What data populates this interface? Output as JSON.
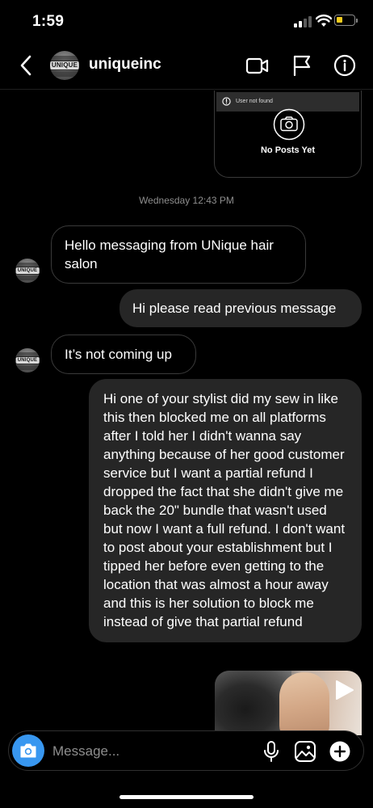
{
  "status_bar": {
    "time": "1:59",
    "battery_level": 0.25,
    "battery_color": "#f4cc1e"
  },
  "header": {
    "username": "uniqueinc",
    "avatar_text": "UNIQUE",
    "icons": [
      "back-chevron-icon",
      "video-call-icon",
      "flag-icon",
      "info-icon"
    ]
  },
  "shared_post": {
    "warning": "User not found",
    "empty_label": "No Posts Yet",
    "icons": [
      "alert-circle-icon",
      "camera-icon"
    ]
  },
  "timestamp": "Wednesday 12:43 PM",
  "messages": [
    {
      "direction": "received",
      "text": "Hello messaging from UNique hair salon"
    },
    {
      "direction": "sent",
      "text": "Hi please read previous message"
    },
    {
      "direction": "received",
      "text": "It’s not coming up"
    },
    {
      "direction": "sent",
      "text": "Hi one of your stylist did my sew in like this then blocked me on all platforms after I told her I didn't wanna say anything because of her good customer service but I want a partial refund I dropped the fact that she didn't give me back the 20\" bundle that wasn't used but now I want a full refund. I don't want to post about your establishment but I tipped her before even getting to the location that was almost a hour away and this is her solution to block me instead of give that partial refund"
    },
    {
      "direction": "sent",
      "type": "video",
      "icon": "play-icon"
    }
  ],
  "composer": {
    "placeholder": "Message...",
    "accent_color": "#3897f0",
    "icons": [
      "camera-icon",
      "microphone-icon",
      "gallery-icon",
      "plus-icon"
    ]
  }
}
